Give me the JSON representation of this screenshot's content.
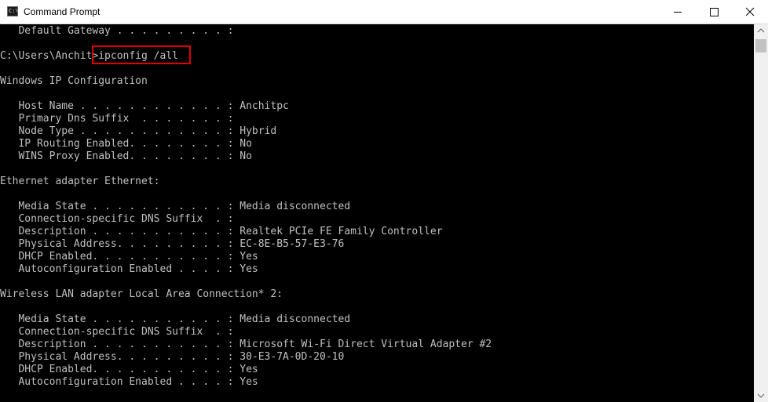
{
  "window": {
    "title": "Command Prompt",
    "app_icon_text": "C:\\"
  },
  "console": {
    "lines": [
      "   Default Gateway . . . . . . . . . :",
      "",
      "C:\\Users\\Anchit>ipconfig /all",
      "",
      "Windows IP Configuration",
      "",
      "   Host Name . . . . . . . . . . . . : Anchitpc",
      "   Primary Dns Suffix  . . . . . . . :",
      "   Node Type . . . . . . . . . . . . : Hybrid",
      "   IP Routing Enabled. . . . . . . . : No",
      "   WINS Proxy Enabled. . . . . . . . : No",
      "",
      "Ethernet adapter Ethernet:",
      "",
      "   Media State . . . . . . . . . . . : Media disconnected",
      "   Connection-specific DNS Suffix  . :",
      "   Description . . . . . . . . . . . : Realtek PCIe FE Family Controller",
      "   Physical Address. . . . . . . . . : EC-8E-B5-57-E3-76",
      "   DHCP Enabled. . . . . . . . . . . : Yes",
      "   Autoconfiguration Enabled . . . . : Yes",
      "",
      "Wireless LAN adapter Local Area Connection* 2:",
      "",
      "   Media State . . . . . . . . . . . : Media disconnected",
      "   Connection-specific DNS Suffix  . :",
      "   Description . . . . . . . . . . . : Microsoft Wi-Fi Direct Virtual Adapter #2",
      "   Physical Address. . . . . . . . . : 30-E3-7A-0D-20-10",
      "   DHCP Enabled. . . . . . . . . . . : Yes",
      "   Autoconfiguration Enabled . . . . : Yes"
    ]
  },
  "colors": {
    "console_background": "#000000",
    "console_text": "#c0c0c0",
    "highlight_box": "#e00000"
  },
  "icons": {
    "minimize": "minimize-icon",
    "maximize": "maximize-icon",
    "close": "close-icon",
    "scroll_up": "scroll-up-arrow-icon",
    "scroll_down": "scroll-down-arrow-icon"
  }
}
